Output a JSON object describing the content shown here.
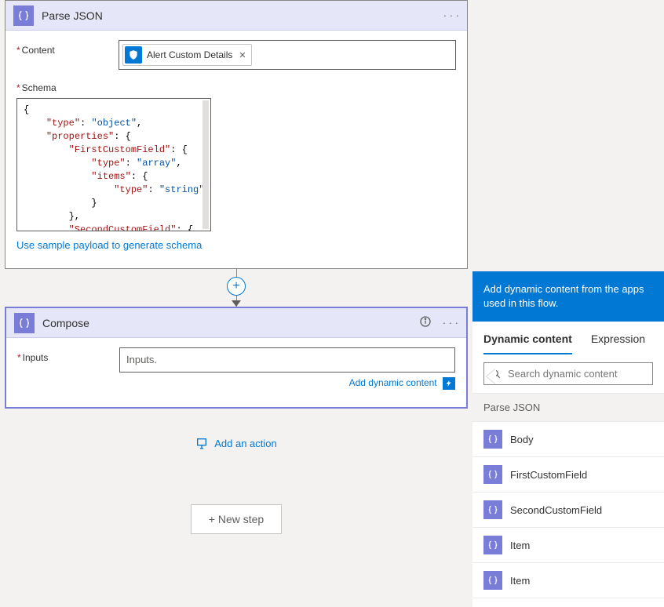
{
  "parseJson": {
    "title": "Parse JSON",
    "contentLabel": "Content",
    "schemaLabel": "Schema",
    "token": "Alert Custom Details",
    "schemaLines": [
      {
        "indent": 0,
        "text": "{"
      },
      {
        "indent": 2,
        "key": "type",
        "val": "object",
        "trail": ","
      },
      {
        "indent": 2,
        "key": "properties",
        "openObj": true
      },
      {
        "indent": 4,
        "key": "FirstCustomField",
        "openObj": true
      },
      {
        "indent": 6,
        "key": "type",
        "val": "array",
        "trail": ","
      },
      {
        "indent": 6,
        "key": "items",
        "openObj": true
      },
      {
        "indent": 8,
        "key": "type",
        "val": "string"
      },
      {
        "indent": 6,
        "text": "}"
      },
      {
        "indent": 4,
        "text": "},"
      },
      {
        "indent": 4,
        "key": "SecondCustomField",
        "openObj": true,
        "cutoff": true
      }
    ],
    "sampleLink": "Use sample payload to generate schema"
  },
  "compose": {
    "title": "Compose",
    "inputsLabel": "Inputs",
    "inputsPlaceholder": "Inputs.",
    "addDynamic": "Add dynamic content"
  },
  "addAction": "Add an action",
  "newStep": "+ New step",
  "panel": {
    "banner": "Add dynamic content from the apps used in this flow.",
    "tabDynamic": "Dynamic content",
    "tabExpression": "Expression",
    "searchPlaceholder": "Search dynamic content",
    "groupHeader": "Parse JSON",
    "items": [
      "Body",
      "FirstCustomField",
      "SecondCustomField",
      "Item",
      "Item"
    ]
  }
}
